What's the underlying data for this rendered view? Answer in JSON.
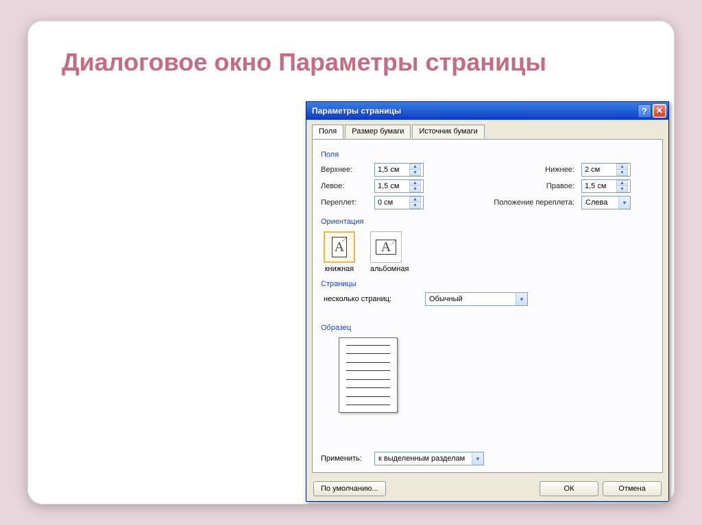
{
  "slide": {
    "title": "Диалоговое окно Параметры страницы"
  },
  "dialog": {
    "title": "Параметры страницы",
    "help_symbol": "?",
    "close_symbol": "✕",
    "tabs": {
      "fields": "Поля",
      "paper_size": "Размер бумаги",
      "paper_source": "Источник бумаги"
    },
    "groups": {
      "fields": "Поля",
      "orientation": "Ориентация",
      "pages": "Страницы",
      "preview": "Образец"
    },
    "margins": {
      "top_label": "Верхнее:",
      "top_value": "1,5 см",
      "bottom_label": "Нижнее:",
      "bottom_value": "2 см",
      "left_label": "Левое:",
      "left_value": "1,5 см",
      "right_label": "Правое:",
      "right_value": "1,5 см",
      "gutter_label": "Переплет:",
      "gutter_value": "0 см",
      "gutter_pos_label": "Положение переплета:",
      "gutter_pos_value": "Слева"
    },
    "orientation": {
      "portrait": "книжная",
      "landscape": "альбомная",
      "glyph": "A"
    },
    "pages": {
      "multi_label": "несколько страниц:",
      "multi_value": "Обычный"
    },
    "apply": {
      "label": "Применить:",
      "value": "к выделенным разделам"
    },
    "buttons": {
      "default": "По умолчанию...",
      "ok": "ОК",
      "cancel": "Отмена"
    }
  }
}
